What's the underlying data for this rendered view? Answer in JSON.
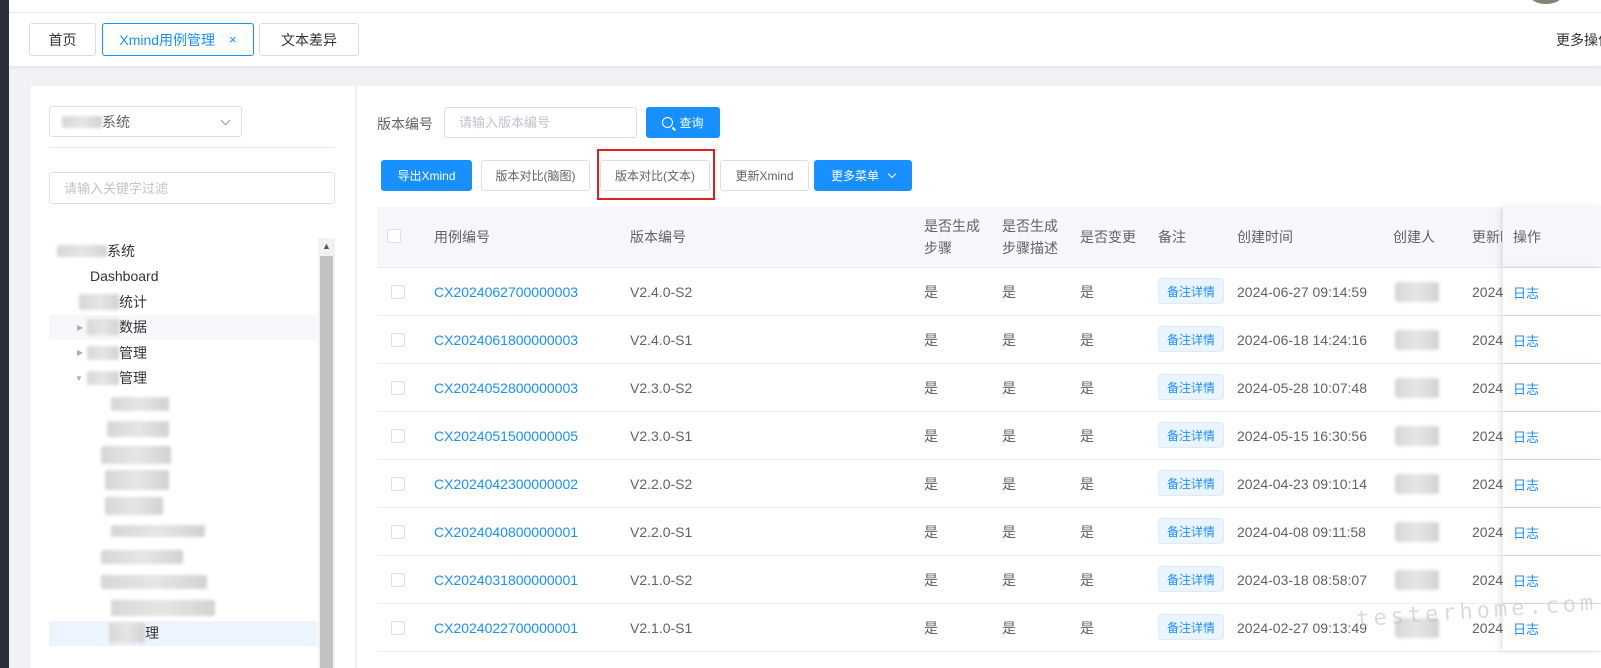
{
  "tags": [
    {
      "label": "首页",
      "active": false
    },
    {
      "label": "Xmind用例管理",
      "active": true,
      "close": "×"
    },
    {
      "label": "文本差异",
      "active": false
    }
  ],
  "header": {
    "more_ops": "更多操作"
  },
  "sidebar": {
    "system_select": {
      "suffix": "系统"
    },
    "filter_placeholder": "请输入关键字过滤",
    "tree": [
      {
        "label": "系统",
        "indent": 1
      },
      {
        "label": "Dashboard",
        "indent": 2
      },
      {
        "label": "统计",
        "indent": 2
      },
      {
        "label": "数据",
        "indent": 2
      },
      {
        "label": "管理",
        "indent": 2
      },
      {
        "label": "管理",
        "indent": 2
      },
      {
        "label": "",
        "indent": 3
      },
      {
        "label": "",
        "indent": 3
      },
      {
        "label": "",
        "indent": 3
      },
      {
        "label": "",
        "indent": 3
      },
      {
        "label": "",
        "indent": 3
      },
      {
        "label": "",
        "indent": 3
      },
      {
        "label": "",
        "indent": 3
      },
      {
        "label": "",
        "indent": 3
      },
      {
        "label": "",
        "indent": 3
      },
      {
        "label": "理",
        "indent": 3
      }
    ]
  },
  "search": {
    "label": "版本编号",
    "placeholder": "请输入版本编号",
    "button": "查询"
  },
  "toolbar": {
    "export": "导出Xmind",
    "compare_mindmap": "版本对比(脑图)",
    "compare_text": "版本对比(文本)",
    "update": "更新Xmind",
    "more_menu": "更多菜单"
  },
  "table": {
    "columns": {
      "case_no": "用例编号",
      "version_no": "版本编号",
      "gen_steps_1": "是否生成",
      "gen_steps_2": "步骤",
      "gen_desc_1": "是否生成",
      "gen_desc_2": "步骤描述",
      "changed": "是否变更",
      "remark": "备注",
      "created_at": "创建时间",
      "creator": "创建人",
      "updated_at": "更新时间",
      "ops": "操作"
    },
    "rows": [
      {
        "case_no": "CX2024062700000003",
        "version": "V2.4.0-S2",
        "gen_steps": "是",
        "gen_desc": "是",
        "changed": "是",
        "remark": "备注详情",
        "created": "2024-06-27 09:14:59",
        "updated": "2024",
        "op": "日志"
      },
      {
        "case_no": "CX2024061800000003",
        "version": "V2.4.0-S1",
        "gen_steps": "是",
        "gen_desc": "是",
        "changed": "是",
        "remark": "备注详情",
        "created": "2024-06-18 14:24:16",
        "updated": "2024",
        "op": "日志"
      },
      {
        "case_no": "CX2024052800000003",
        "version": "V2.3.0-S2",
        "gen_steps": "是",
        "gen_desc": "是",
        "changed": "是",
        "remark": "备注详情",
        "created": "2024-05-28 10:07:48",
        "updated": "2024",
        "op": "日志"
      },
      {
        "case_no": "CX2024051500000005",
        "version": "V2.3.0-S1",
        "gen_steps": "是",
        "gen_desc": "是",
        "changed": "是",
        "remark": "备注详情",
        "created": "2024-05-15 16:30:56",
        "updated": "2024",
        "op": "日志"
      },
      {
        "case_no": "CX2024042300000002",
        "version": "V2.2.0-S2",
        "gen_steps": "是",
        "gen_desc": "是",
        "changed": "是",
        "remark": "备注详情",
        "created": "2024-04-23 09:10:14",
        "updated": "2024",
        "op": "日志"
      },
      {
        "case_no": "CX2024040800000001",
        "version": "V2.2.0-S1",
        "gen_steps": "是",
        "gen_desc": "是",
        "changed": "是",
        "remark": "备注详情",
        "created": "2024-04-08 09:11:58",
        "updated": "2024",
        "op": "日志"
      },
      {
        "case_no": "CX2024031800000001",
        "version": "V2.1.0-S2",
        "gen_steps": "是",
        "gen_desc": "是",
        "changed": "是",
        "remark": "备注详情",
        "created": "2024-03-18 08:58:07",
        "updated": "2024",
        "op": "日志"
      },
      {
        "case_no": "CX2024022700000001",
        "version": "V2.1.0-S1",
        "gen_steps": "是",
        "gen_desc": "是",
        "changed": "是",
        "remark": "备注详情",
        "created": "2024-02-27 09:13:49",
        "updated": "2024",
        "op": "日志"
      }
    ]
  },
  "watermark": "testerhome.com",
  "colors": {
    "primary": "#1890ff",
    "highlight": "#e02020"
  }
}
